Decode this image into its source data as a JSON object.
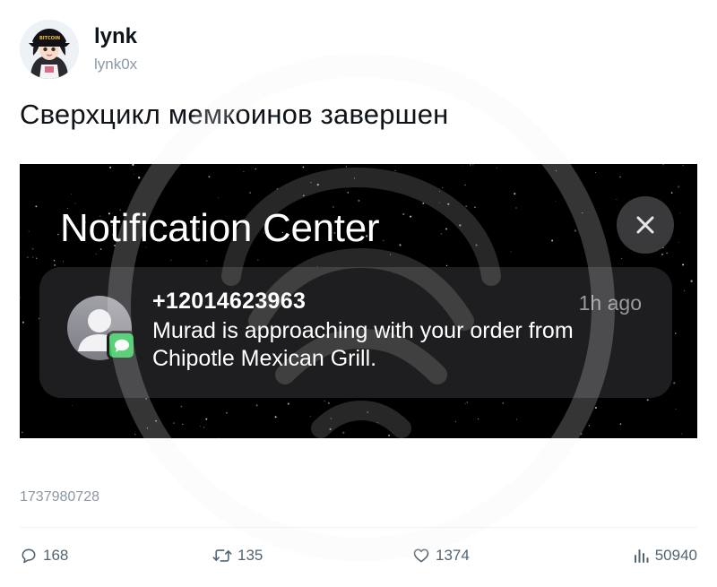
{
  "tweet": {
    "author": {
      "display_name": "lynk",
      "handle": "lynk0x"
    },
    "text": "Сверхцикл мемкоинов завершен",
    "timestamp": "1737980728"
  },
  "media": {
    "title": "Notification Center",
    "close_icon": "close-x-icon",
    "notification": {
      "sender": "+12014623963",
      "time": "1h ago",
      "body": "Murad is approaching with your order from Chipotle Mexican Grill.",
      "app_icon": "messages-icon"
    }
  },
  "actions": {
    "replies": "168",
    "retweets": "135",
    "likes": "1374",
    "views": "50940"
  },
  "colors": {
    "text": "#0f1419",
    "muted": "#8b98a5",
    "notification_card": "#1e1e20",
    "messages_green": "#34c759"
  }
}
